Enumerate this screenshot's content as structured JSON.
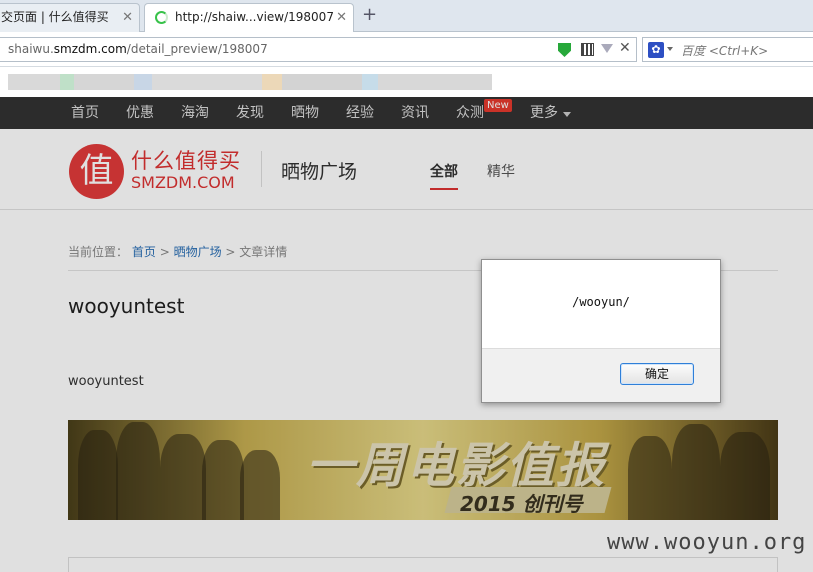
{
  "browser": {
    "tabs": [
      {
        "title": "交页面 | 什么值得买"
      },
      {
        "title": "http://shaiw...view/198007"
      }
    ],
    "url_prefix": "shaiwu.",
    "url_domain": "smzdm.com",
    "url_path": "/detail_preview/198007",
    "search_placeholder": "百度 <Ctrl+K>"
  },
  "nav": {
    "items": [
      "首页",
      "优惠",
      "海淘",
      "发现",
      "晒物",
      "经验",
      "资讯",
      "众测",
      "更多"
    ],
    "new_badge": "New"
  },
  "header": {
    "logo_char": "值",
    "logo_cn": "什么值得买",
    "logo_en": "SMZDM.COM",
    "section": "晒物广场",
    "tabs": [
      "全部",
      "精华"
    ]
  },
  "breadcrumb": {
    "prefix": "当前位置：",
    "home": "首页",
    "sep1": " > ",
    "section": "晒物广场",
    "current": " > 文章详情"
  },
  "article": {
    "title": "wooyuntest",
    "body": "wooyuntest"
  },
  "banner": {
    "title": "一周电影值报",
    "subtitle": "2015 创刊号"
  },
  "dialog": {
    "message": "/wooyun/",
    "ok_label": "确定"
  },
  "watermark": "www.wooyun.org",
  "colors": {
    "accent": "#d33333",
    "nav_bg": "#333333"
  }
}
